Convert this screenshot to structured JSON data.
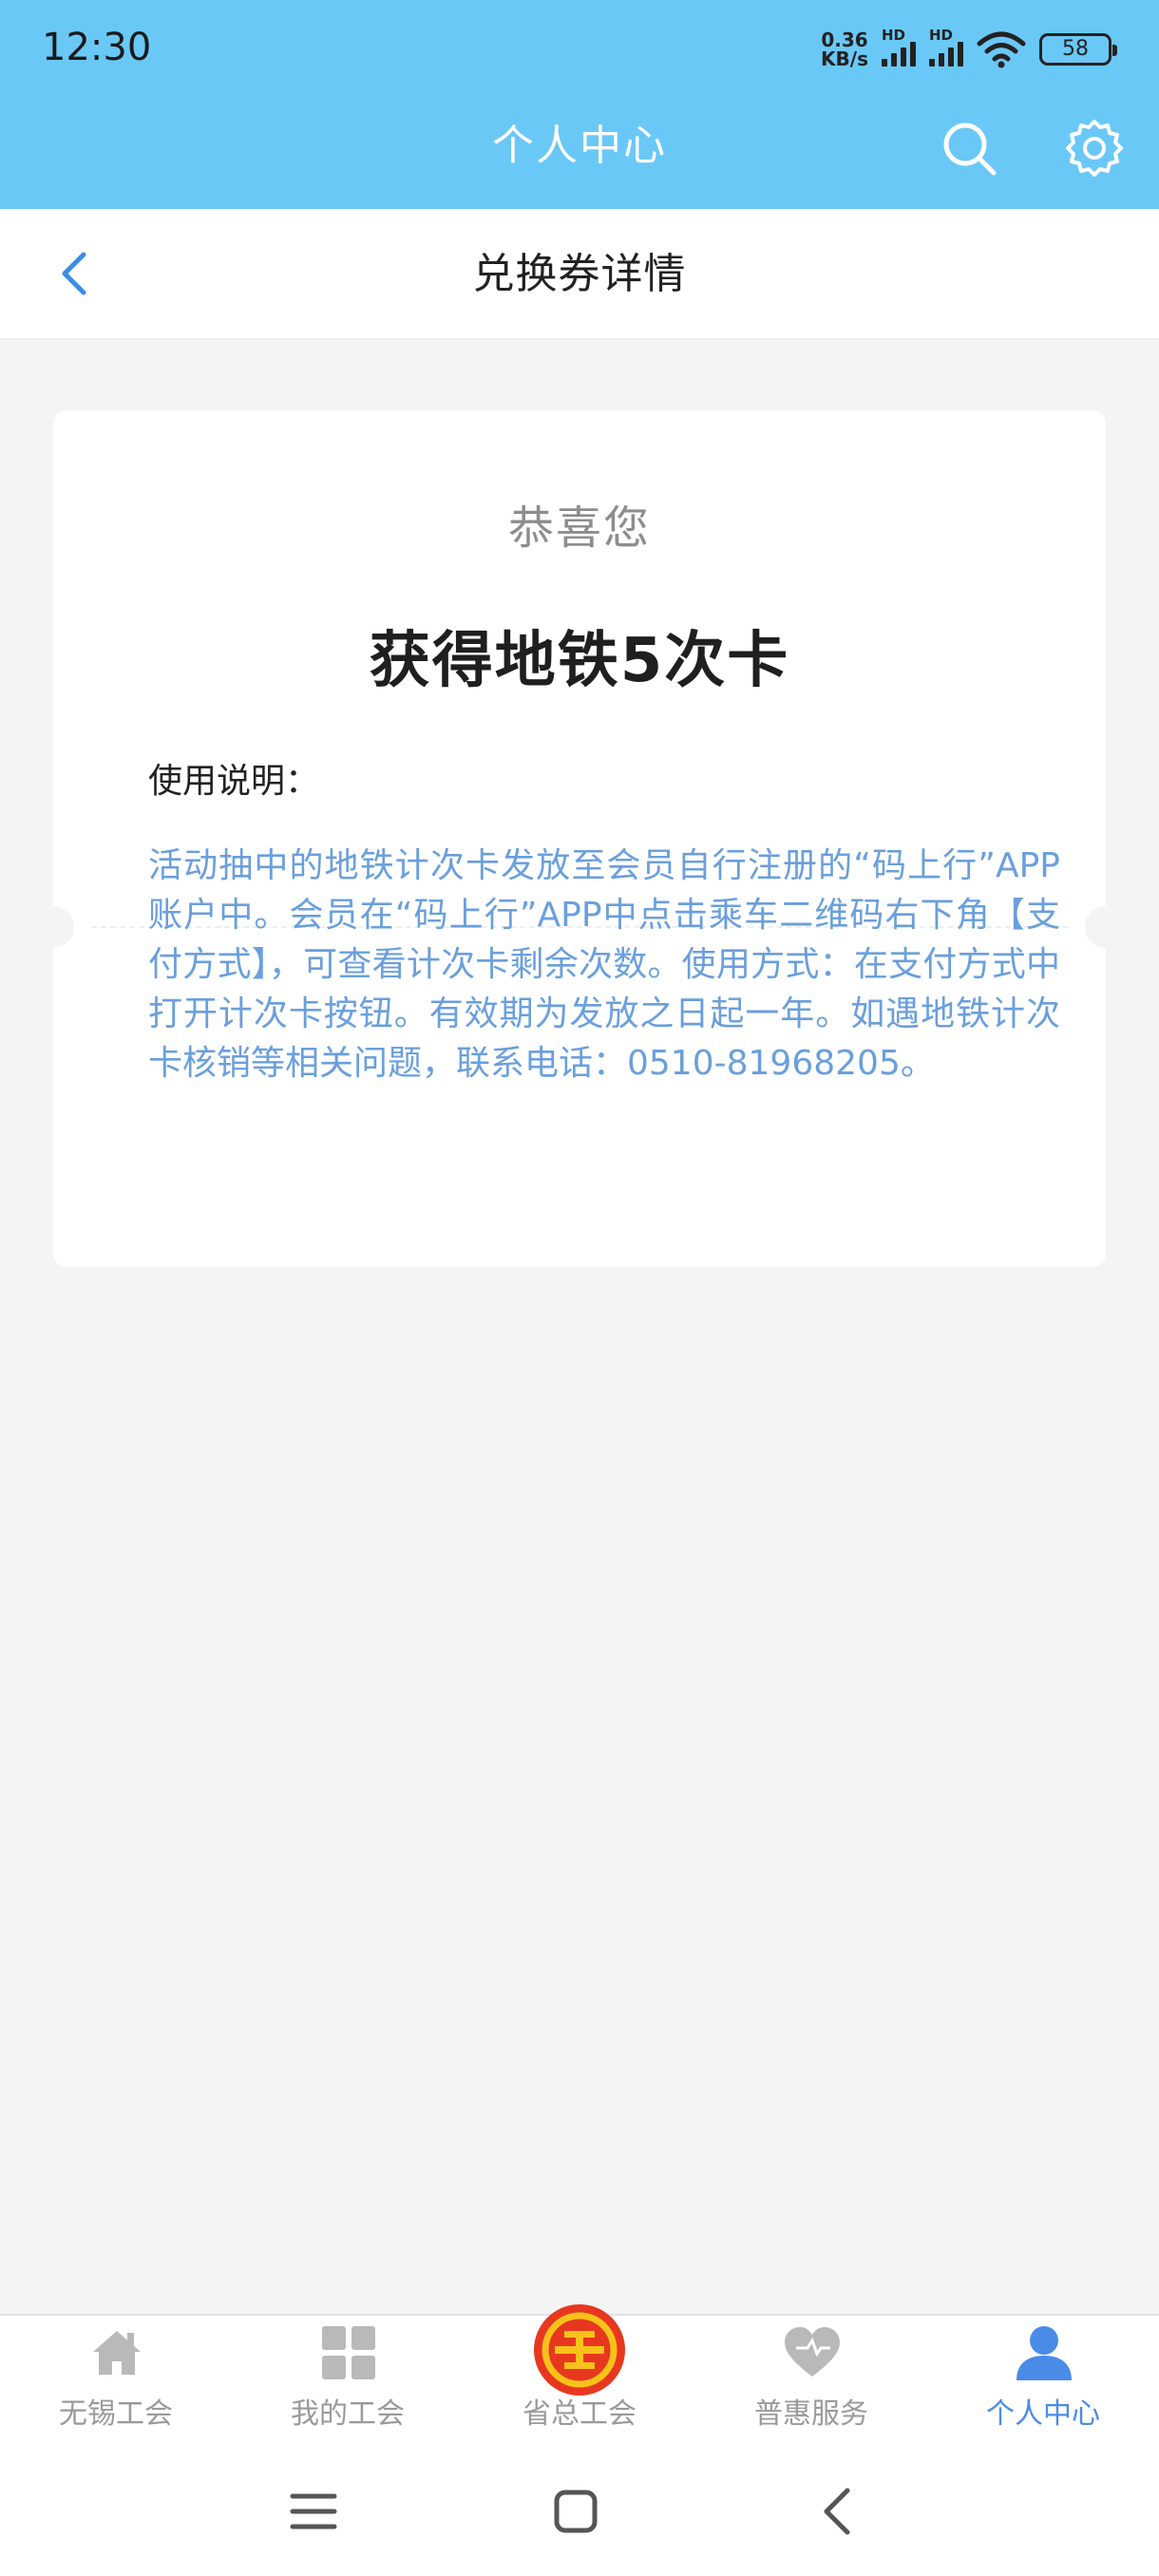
{
  "status_bar": {
    "time": "12:30",
    "net_speed_value": "0.36",
    "net_speed_unit": "KB/s",
    "signal_label_1": "HD",
    "signal_label_2": "HD",
    "battery": "58"
  },
  "header": {
    "title": "个人中心",
    "icons": [
      "search-icon",
      "gear-icon"
    ]
  },
  "sub_header": {
    "title": "兑换券详情"
  },
  "coupon": {
    "congrats": "恭喜您",
    "prize": "获得地铁5次卡",
    "usage_label": "使用说明：",
    "usage_text": "活动抽中的地铁计次卡发放至会员自行注册的“码上行”APP账户中。会员在“码上行”APP中点击乘车二维码右下角【支付方式】，可查看计次卡剩余次数。使用方式：在支付方式中打开计次卡按钮。有效期为发放之日起一年。如遇地铁计次卡核销等相关问题，联系电话：0510-81968205。"
  },
  "bottom_nav": {
    "items": [
      {
        "label": "无锡工会",
        "icon": "home-icon"
      },
      {
        "label": "我的工会",
        "icon": "grid-icon"
      },
      {
        "label": "省总工会",
        "icon": "union-emblem-icon"
      },
      {
        "label": "普惠服务",
        "icon": "heart-icon"
      },
      {
        "label": "个人中心",
        "icon": "person-icon"
      }
    ],
    "active_index": 4
  },
  "colors": {
    "header_blue": "#6ac8f7",
    "link_blue": "#6a9fdc",
    "active_blue": "#4a8be8",
    "emblem_red": "#e8371f"
  }
}
